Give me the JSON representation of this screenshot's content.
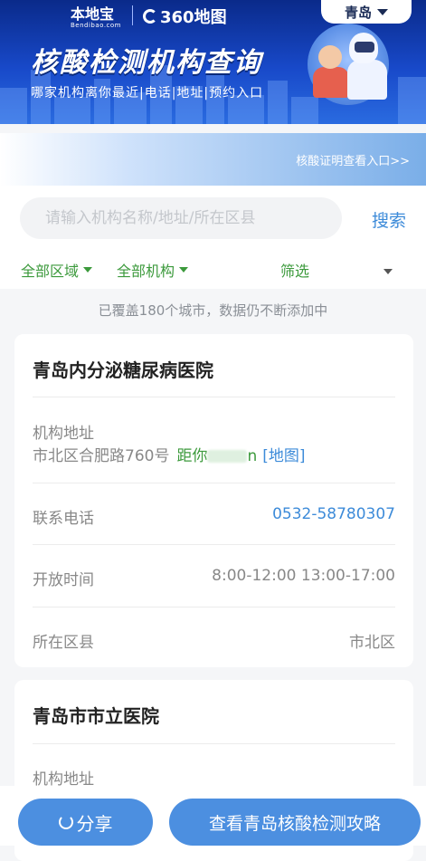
{
  "banner": {
    "logo_primary": "本地宝",
    "logo_primary_sub": "Bendibao.com",
    "logo_secondary": "360地图",
    "title": "核酸检测机构查询",
    "subtitle": "哪家机构离你最近|电话|地址|预约入口",
    "city_selected": "青岛"
  },
  "cert_link": "核酸证明查看入口>>",
  "search": {
    "placeholder": "请输入机构名称/地址/所在区县",
    "button_label": "搜索"
  },
  "filters": {
    "region": "全部区域",
    "institution": "全部机构",
    "screen": "筛选"
  },
  "notice": "已覆盖180个城市，数据仍不断添加中",
  "institutions": [
    {
      "name": "青岛内分泌糖尿病医院",
      "address_label": "机构地址",
      "address": "市北区合肥路760号",
      "distance_label": "距你",
      "distance_unit": "n",
      "map_link": "[地图]",
      "phone_label": "联系电话",
      "phone": "0532-58780307",
      "hours_label": "开放时间",
      "hours": "8:00-12:00 13:00-17:00",
      "district_label": "所在区县",
      "district": "市北区"
    },
    {
      "name": "青岛市市立医院",
      "address_label": "机构地址"
    }
  ],
  "bottom": {
    "share_label": "分享",
    "guide_label": "查看青岛核酸检测攻略"
  },
  "colors": {
    "accent_blue": "#4c8fe0",
    "link_blue": "#3d8bd9",
    "filter_green": "#3c9a3c"
  }
}
